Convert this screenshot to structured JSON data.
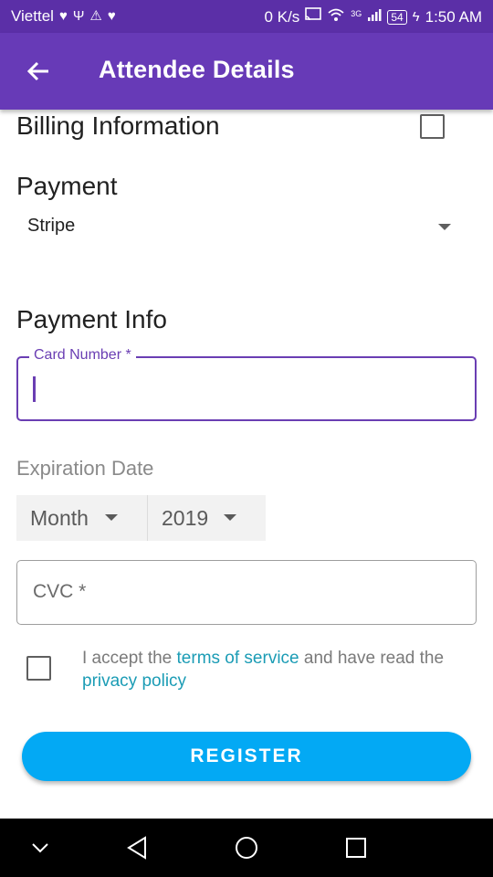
{
  "status_bar": {
    "carrier": "Viettel",
    "network_speed": "0 K/s",
    "network_type": "3G",
    "battery": "54",
    "time": "1:50 AM"
  },
  "app_bar": {
    "title": "Attendee Details",
    "back_icon": "arrow-back-icon"
  },
  "billing": {
    "title": "Billing Information",
    "checked": false
  },
  "payment": {
    "title": "Payment",
    "selected": "Stripe"
  },
  "payment_info": {
    "title": "Payment Info",
    "card_number_label": "Card Number *",
    "card_number_value": "",
    "expiration_label": "Expiration Date",
    "month_selected": "Month",
    "year_selected": "2019",
    "cvc_label": "CVC *"
  },
  "terms": {
    "checked": false,
    "text_1": "I accept the ",
    "link_1": "terms of service",
    "text_2": " and have read the ",
    "link_2": "privacy policy"
  },
  "register": {
    "label": "REGISTER"
  },
  "colors": {
    "status_bar": "#5b2fa7",
    "app_bar": "#673ab7",
    "accent": "#6a3eb3",
    "button": "#03a9f4",
    "link": "#1b9cb5"
  },
  "nav_bar": {
    "icons": [
      "chevron-down-icon",
      "back-triangle-icon",
      "home-circle-icon",
      "recents-square-icon"
    ]
  }
}
